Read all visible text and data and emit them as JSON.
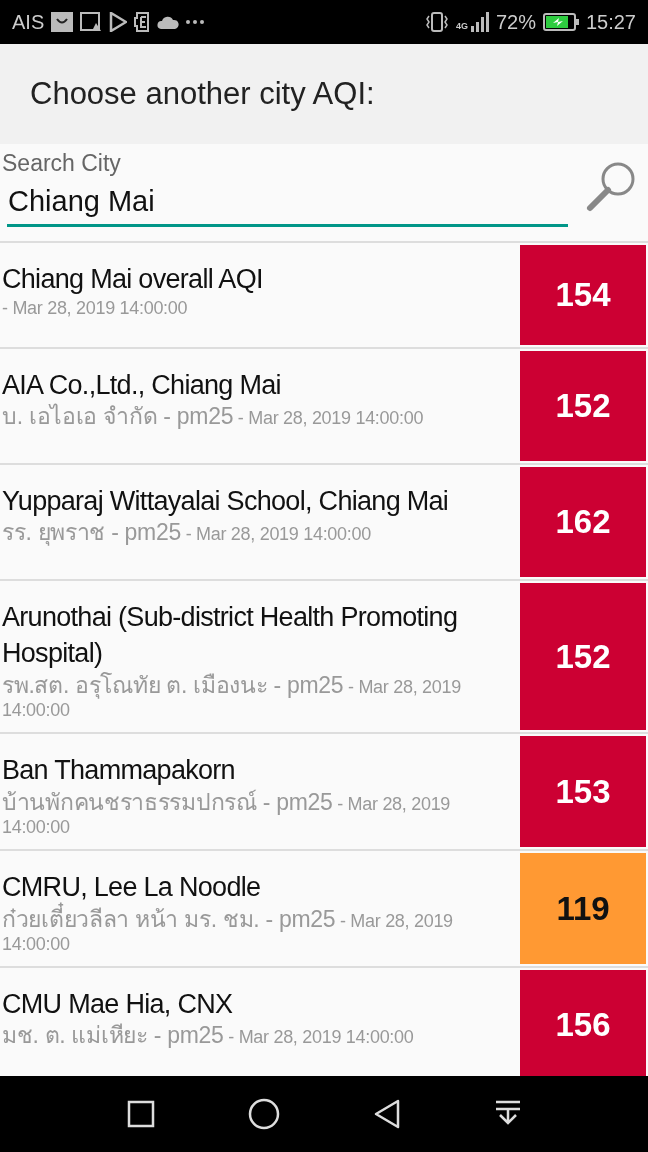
{
  "status_bar": {
    "carrier": "AIS",
    "network": "4G",
    "battery": "72%",
    "time": "15:27"
  },
  "header": {
    "title": "Choose another city AQI:"
  },
  "search": {
    "label": "Search City",
    "value": "Chiang Mai"
  },
  "stations": [
    {
      "name": "Chiang Mai overall AQI",
      "time": "- Mar 28, 2019 14:00:00",
      "aqi": "154",
      "color": "#cc0033"
    },
    {
      "name": "AIA Co.,Ltd., Chiang Mai",
      "sub": "บ. เอไอเอ จำกัด - pm25",
      "time": " - Mar 28, 2019 14:00:00",
      "aqi": "152",
      "color": "#cc0033"
    },
    {
      "name": "Yupparaj Wittayalai School, Chiang Mai",
      "sub": "รร. ยุพราช - pm25",
      "time": " - Mar 28, 2019 14:00:00",
      "aqi": "162",
      "color": "#cc0033"
    },
    {
      "name": "Arunothai (Sub-district Health Promoting Hospital)",
      "sub": "รพ.สต. อรุโณทัย ต. เมืองนะ - pm25",
      "time": " - Mar 28, 2019 14:00:00",
      "aqi": "152",
      "color": "#cc0033"
    },
    {
      "name": "Ban Thammapakorn",
      "sub": "บ้านพักคนชราธรรมปกรณ์ - pm25",
      "time": " - Mar 28, 2019 14:00:00",
      "aqi": "153",
      "color": "#cc0033"
    },
    {
      "name": "CMRU, Lee La Noodle",
      "sub": "ก๋วยเตี๋ยวลีลา หน้า มร. ชม. - pm25",
      "time": " - Mar 28, 2019 14:00:00",
      "aqi": "119",
      "color": "#ff9933"
    },
    {
      "name": "CMU Mae Hia, CNX",
      "sub": "มช. ต. แม่เหียะ - pm25",
      "time": " - Mar 28, 2019 14:00:00",
      "aqi": "156",
      "color": "#cc0033"
    }
  ]
}
